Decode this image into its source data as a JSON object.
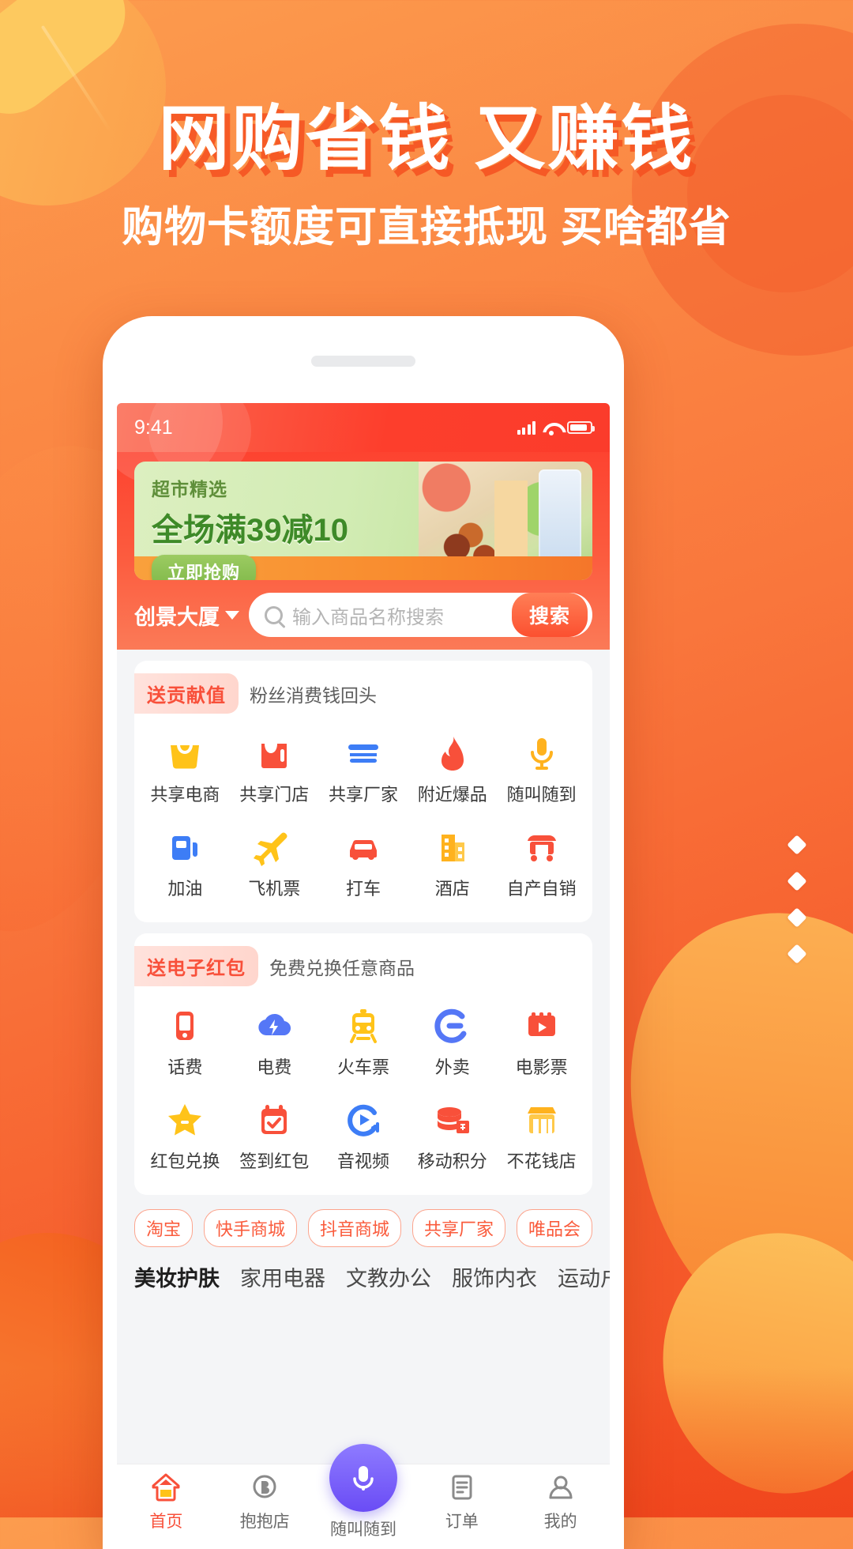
{
  "promo_page": {
    "headline": "网购省钱 又赚钱",
    "subhead": "购物卡额度可直接抵现 买啥都省"
  },
  "phone": {
    "status": {
      "time": "9:41",
      "signal_icon": "signal-bars-icon",
      "wifi_icon": "wifi-icon",
      "battery_icon": "battery-icon"
    },
    "banner": {
      "eyebrow": "超市精选",
      "title": "全场满39减10",
      "cta": "立即抢购"
    },
    "search": {
      "location": "创景大厦",
      "placeholder": "输入商品名称搜索",
      "button": "搜索"
    },
    "sections": [
      {
        "chip": "送贡献值",
        "subtitle": "粉丝消费钱回头",
        "items": [
          {
            "label": "共享电商",
            "icon": "shopping-bag-icon",
            "color": "#FFC319"
          },
          {
            "label": "共享门店",
            "icon": "store-tag-icon",
            "color": "#F8503A"
          },
          {
            "label": "共享厂家",
            "icon": "factory-shop-icon",
            "color": "#3D7DF6"
          },
          {
            "label": "附近爆品",
            "icon": "flame-icon",
            "color": "#F8503A"
          },
          {
            "label": "随叫随到",
            "icon": "microphone-icon",
            "color": "#FFB21E"
          },
          {
            "label": "加油",
            "icon": "fuel-pump-icon",
            "color": "#3D7DF6"
          },
          {
            "label": "飞机票",
            "icon": "airplane-icon",
            "color": "#FFC319"
          },
          {
            "label": "打车",
            "icon": "taxi-car-icon",
            "color": "#F8503A"
          },
          {
            "label": "酒店",
            "icon": "hotel-building-icon",
            "color": "#FFB21E"
          },
          {
            "label": "自产自销",
            "icon": "market-stall-icon",
            "color": "#F8503A"
          }
        ]
      },
      {
        "chip": "送电子红包",
        "subtitle": "免费兑换任意商品",
        "items": [
          {
            "label": "话费",
            "icon": "mobile-phone-icon",
            "color": "#F8503A"
          },
          {
            "label": "电费",
            "icon": "electric-cloud-icon",
            "color": "#5577F6"
          },
          {
            "label": "火车票",
            "icon": "train-icon",
            "color": "#FFC319"
          },
          {
            "label": "外卖",
            "icon": "takeout-ele-icon",
            "color": "#5577F6"
          },
          {
            "label": "电影票",
            "icon": "movie-ticket-icon",
            "color": "#F8503A"
          },
          {
            "label": "红包兑换",
            "icon": "star-icon",
            "color": "#FFC319"
          },
          {
            "label": "签到红包",
            "icon": "calendar-check-icon",
            "color": "#F8503A"
          },
          {
            "label": "音视频",
            "icon": "play-media-icon",
            "color": "#3D7DF6"
          },
          {
            "label": "移动积分",
            "icon": "coin-stack-icon",
            "color": "#F8503A"
          },
          {
            "label": "不花钱店",
            "icon": "free-store-icon",
            "color": "#FFB21E"
          }
        ]
      }
    ],
    "brands": [
      "淘宝",
      "快手商城",
      "抖音商城",
      "共享厂家",
      "唯品会"
    ],
    "categories": [
      "美妆护肤",
      "家用电器",
      "文教办公",
      "服饰内衣",
      "运动户外"
    ],
    "tabbar": [
      {
        "label": "首页",
        "icon": "home-icon",
        "active": true
      },
      {
        "label": "抱抱店",
        "icon": "hug-store-icon",
        "active": false
      },
      {
        "label": "随叫随到",
        "icon": "microphone-fab-icon",
        "active": false
      },
      {
        "label": "订单",
        "icon": "order-list-icon",
        "active": false
      },
      {
        "label": "我的",
        "icon": "user-profile-icon",
        "active": false
      }
    ]
  },
  "colors": {
    "brand_orange": "#F8503A",
    "bg_start": "#FC9C4E",
    "bg_end": "#F34E22"
  }
}
